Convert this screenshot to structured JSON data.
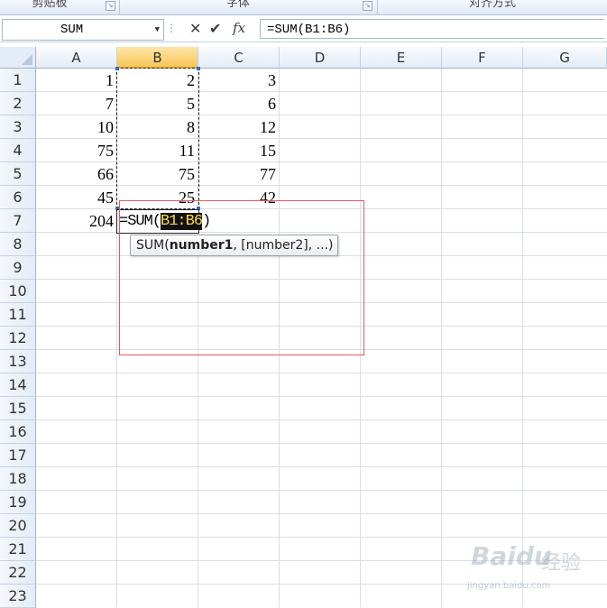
{
  "ribbon": {
    "groups": [
      "剪贴板",
      "字体",
      "对齐方式"
    ]
  },
  "formula_bar": {
    "name_box": "SUM",
    "cancel_icon": "✕",
    "enter_icon": "✔",
    "fx_icon": "fx",
    "formula": "=SUM(B1:B6)"
  },
  "columns": [
    "A",
    "B",
    "C",
    "D",
    "E",
    "F",
    "G"
  ],
  "selected_column": "B",
  "rows": [
    "1",
    "2",
    "3",
    "4",
    "5",
    "6",
    "7",
    "8",
    "9",
    "10",
    "11",
    "12",
    "13",
    "14",
    "15",
    "16",
    "17",
    "18",
    "19",
    "20",
    "21",
    "22",
    "23"
  ],
  "cells": {
    "A": [
      "1",
      "7",
      "10",
      "75",
      "66",
      "45",
      "204"
    ],
    "B": [
      "2",
      "5",
      "8",
      "11",
      "75",
      "25"
    ],
    "C": [
      "3",
      "6",
      "12",
      "15",
      "77",
      "42"
    ]
  },
  "edit_cell": {
    "prefix": "=SUM(",
    "range": "B1:B6",
    "suffix": ")"
  },
  "tooltip": {
    "fn": "SUM(",
    "arg_bold": "number1",
    "rest": ", [number2], ...)"
  },
  "colors": {
    "range_highlight_bg": "#111111",
    "range_highlight_fg": "#ffd84a",
    "annotation_box": "#e8595a"
  },
  "watermark": {
    "brand": "Baidu",
    "suffix": "经验",
    "url": "jingyan.baidu.com"
  }
}
